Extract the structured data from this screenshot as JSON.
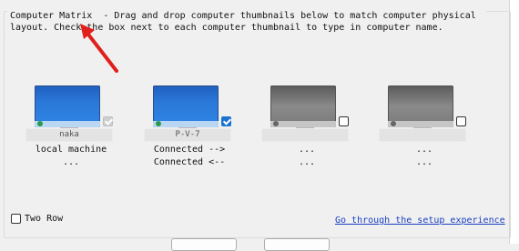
{
  "group": {
    "title": "Computer Matrix  - Drag and drop computer thumbnails below to match computer physical layout. Check the box next to each computer thumbnail to type in computer name."
  },
  "computers": [
    {
      "name": "naka",
      "line1": "local machine",
      "line2": "...",
      "state": "active",
      "checkbox": "disabled-checked"
    },
    {
      "name": "P-V-7",
      "line1": "Connected -->",
      "line2": "Connected <--",
      "state": "active",
      "checkbox": "checked"
    },
    {
      "name": "",
      "line1": "...",
      "line2": "...",
      "state": "inactive",
      "checkbox": "unchecked"
    },
    {
      "name": "",
      "line1": "...",
      "line2": "...",
      "state": "inactive",
      "checkbox": "unchecked"
    }
  ],
  "options": {
    "two_row_label": "Two Row",
    "two_row_checked": false
  },
  "links": {
    "setup": "Go through the setup experience"
  },
  "colors": {
    "annotation_arrow": "#e0201c",
    "link": "#1a3fc0",
    "checkbox_checked": "#1a73d1"
  }
}
